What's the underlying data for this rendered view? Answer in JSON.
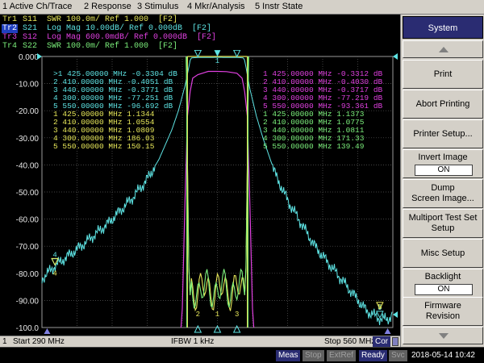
{
  "menu": [
    "1 Active Ch/Trace",
    "2 Response",
    "3 Stimulus",
    "4 Mkr/Analysis",
    "5 Instr State"
  ],
  "traces": [
    {
      "id": "Tr1",
      "text": " S11  SWR 100.0m/ Ref 1.000  [F2]",
      "color": "#e8e85a",
      "selected": false
    },
    {
      "id": "Tr2",
      "text": " S21  Log Mag 10.00dB/ Ref 0.000dB  [F2]",
      "color": "#5ee4e4",
      "selected": true
    },
    {
      "id": "Tr3",
      "text": " S12  Log Mag 600.0mdB/ Ref 0.000dB  [F2]",
      "color": "#e040e0",
      "selected": false
    },
    {
      "id": "Tr4",
      "text": " S22  SWR 100.0m/ Ref 1.000  [F2]",
      "color": "#7cf07c",
      "selected": false
    }
  ],
  "colors": {
    "tr1": "#e8e85a",
    "tr2": "#5ee4e4",
    "tr3": "#e040e0",
    "tr4": "#7cf07c",
    "grid": "#5a5a5a",
    "label": "#e8e8e8",
    "panel_title_bg": "#2a2c72"
  },
  "marker_tables": [
    {
      "color": "#5ee4e4",
      "rows": [
        {
          "n": "1",
          "freq": "425.00000 MHz",
          "val": "-0.3304 dB",
          "prefix": ">"
        },
        {
          "n": "2",
          "freq": "410.00000 MHz",
          "val": "-0.4051 dB",
          "prefix": ""
        },
        {
          "n": "3",
          "freq": "440.00000 MHz",
          "val": "-0.3771 dB",
          "prefix": ""
        },
        {
          "n": "4",
          "freq": "300.00000 MHz",
          "val": "-77.251 dB",
          "prefix": ""
        },
        {
          "n": "5",
          "freq": "550.00000 MHz",
          "val": "-96.692 dB",
          "prefix": ""
        }
      ]
    },
    {
      "color": "#e8e85a",
      "rows": [
        {
          "n": "1",
          "freq": "425.00000 MHz",
          "val": "1.1344",
          "prefix": ""
        },
        {
          "n": "2",
          "freq": "410.00000 MHz",
          "val": "1.0554",
          "prefix": ""
        },
        {
          "n": "3",
          "freq": "440.00000 MHz",
          "val": "1.0809",
          "prefix": ""
        },
        {
          "n": "4",
          "freq": "300.00000 MHz",
          "val": "186.03",
          "prefix": ""
        },
        {
          "n": "5",
          "freq": "550.00000 MHz",
          "val": "150.15",
          "prefix": ""
        }
      ]
    },
    {
      "color": "#e040e0",
      "rows": [
        {
          "n": "1",
          "freq": "425.00000 MHz",
          "val": "-0.3312 dB",
          "prefix": ""
        },
        {
          "n": "2",
          "freq": "410.00000 MHz",
          "val": "-0.4030 dB",
          "prefix": ""
        },
        {
          "n": "3",
          "freq": "440.00000 MHz",
          "val": "-0.3717 dB",
          "prefix": ""
        },
        {
          "n": "4",
          "freq": "300.00000 MHz",
          "val": "-77.219 dB",
          "prefix": ""
        },
        {
          "n": "5",
          "freq": "550.00000 MHz",
          "val": "-93.361 dB",
          "prefix": ""
        }
      ]
    },
    {
      "color": "#7cf07c",
      "rows": [
        {
          "n": "1",
          "freq": "425.00000 MHz",
          "val": "1.1373",
          "prefix": ""
        },
        {
          "n": "2",
          "freq": "410.00000 MHz",
          "val": "1.0775",
          "prefix": ""
        },
        {
          "n": "3",
          "freq": "440.00000 MHz",
          "val": "1.0811",
          "prefix": ""
        },
        {
          "n": "4",
          "freq": "300.00000 MHz",
          "val": "171.33",
          "prefix": ""
        },
        {
          "n": "5",
          "freq": "550.00000 MHz",
          "val": "139.49",
          "prefix": ""
        }
      ]
    }
  ],
  "chart_data": {
    "type": "line",
    "xlabel": "",
    "ylabel": "",
    "x_range_mhz": [
      290,
      560
    ],
    "ylim": [
      -100,
      0
    ],
    "y_ticks": [
      "0.000",
      "-10.00",
      "-20.00",
      "-30.00",
      "-40.00",
      "-50.00",
      "-60.00",
      "-70.00",
      "-80.00",
      "-90.00",
      "-100.0"
    ],
    "grid": true,
    "series": [
      {
        "name": "S21",
        "color": "#5ee4e4",
        "x": [
          290,
          300,
          320,
          340,
          360,
          370,
          380,
          390,
          395,
          400,
          403,
          404,
          405,
          410,
          425,
          440,
          445,
          446,
          447,
          450,
          455,
          460,
          470,
          480,
          490,
          500,
          510,
          520,
          530,
          540,
          550,
          556,
          560
        ],
        "y": [
          -82,
          -77.3,
          -70,
          -62,
          -52,
          -46,
          -38,
          -27,
          -20,
          -11,
          -4,
          -1.5,
          -0.5,
          -0.4,
          -0.33,
          -0.38,
          -0.5,
          -1.5,
          -4,
          -12,
          -22,
          -30,
          -44,
          -54,
          -62,
          -70,
          -76,
          -82,
          -88,
          -94,
          -96.7,
          -97,
          -95
        ]
      },
      {
        "name": "S12",
        "color": "#e040e0",
        "x": [
          397,
          398,
          400,
          402,
          404,
          406,
          410,
          418,
          425,
          432,
          440,
          444,
          446,
          448,
          450,
          452,
          453
        ],
        "y": [
          -100,
          -93,
          -55,
          -22,
          -13,
          -8,
          -6.7,
          -5.5,
          -5.5,
          -5.6,
          -6.2,
          -8,
          -13,
          -22,
          -55,
          -93,
          -100
        ]
      }
    ],
    "markers": [
      {
        "n": "1",
        "x_mhz": 425
      },
      {
        "n": "2",
        "x_mhz": 410
      },
      {
        "n": "3",
        "x_mhz": 440
      },
      {
        "n": "4",
        "x_mhz": 300
      },
      {
        "n": "5",
        "x_mhz": 550
      }
    ],
    "marker_y": {
      "s21": {
        "1": -0.33,
        "2": -0.41,
        "3": -0.38,
        "4": -77.3,
        "5": -96.7
      },
      "s12": {
        "1": -5.5,
        "2": -6.7,
        "3": -6.2,
        "4": -77.2,
        "5": -93.4
      },
      "swr": {
        "1": 1.1344,
        "2": 1.0554,
        "3": 1.0809
      }
    }
  },
  "status_bar": {
    "channel": "1",
    "start": "Start 290 MHz",
    "ifbw": "IFBW 1 kHz",
    "stop": "Stop 560 MHz",
    "cor": "Cor"
  },
  "panel": {
    "title": "System",
    "keys": [
      {
        "label": "Print"
      },
      {
        "label": "Abort Printing"
      },
      {
        "label": "Printer Setup..."
      },
      {
        "label": "Invert Image",
        "value": "ON"
      },
      {
        "label": "Dump\nScreen Image..."
      },
      {
        "label": "Multiport Test Set\nSetup"
      },
      {
        "label": "Misc Setup"
      },
      {
        "label": "Backlight",
        "value": "ON"
      },
      {
        "label": "Firmware\nRevision"
      }
    ]
  },
  "instr_status": {
    "meas": "Meas",
    "stop": "Stop",
    "extref": "ExtRef",
    "ready": "Ready",
    "svc": "Svc",
    "datetime": "2018-05-14 10:42"
  }
}
